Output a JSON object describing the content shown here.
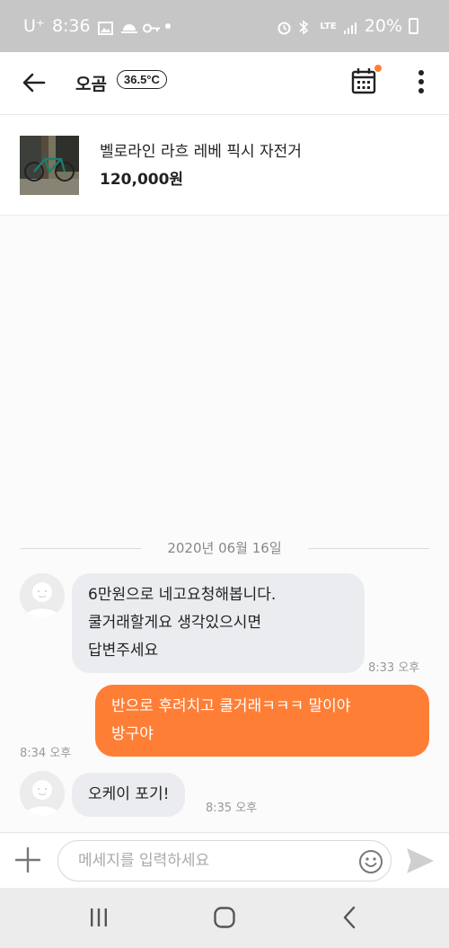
{
  "status_bar": {
    "carrier": "U⁺",
    "time": "8:36",
    "network": "LTE",
    "battery": "20%"
  },
  "header": {
    "title": "오곰",
    "manner_temp": "36.5°C",
    "calendar_notification_color": "#ff7e36"
  },
  "product": {
    "name": "벨로라인 라흐 레베 픽시 자전거",
    "price": "120,000원"
  },
  "chat": {
    "date": "2020년 06월 16일",
    "messages": [
      {
        "sender": "other",
        "lines": [
          "6만원으로 네고요청해봅니다.",
          "쿨거래할게요 생각있으시면",
          "답변주세요"
        ],
        "time": "8:33 오후"
      },
      {
        "sender": "me",
        "lines": [
          "반으로 후려치고 쿨거래ㅋㅋㅋ 말이야",
          "방구야"
        ],
        "time": "8:34 오후"
      },
      {
        "sender": "other",
        "lines": [
          "오케이 포기!"
        ],
        "time": "8:35 오후"
      }
    ]
  },
  "input": {
    "placeholder": "메세지를 입력하세요",
    "value": ""
  },
  "colors": {
    "accent": "#ff7e36",
    "bubble_other": "#ebecef"
  }
}
